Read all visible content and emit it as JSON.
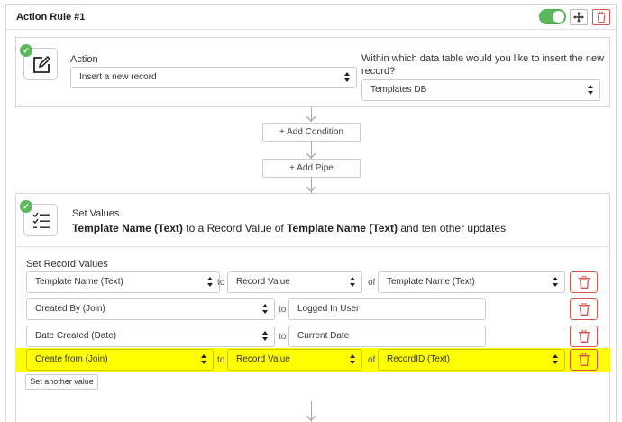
{
  "rule": {
    "title": "Action Rule #1",
    "enabled": true
  },
  "action_card": {
    "action_label": "Action",
    "action_value": "Insert a new record",
    "table_question_line1": "Within which data table would you like to insert the new",
    "table_question_line2": "record?",
    "table_value": "Templates DB"
  },
  "flow": {
    "add_condition": "+ Add Condition",
    "add_pipe": "+ Add Pipe"
  },
  "set_values": {
    "title": "Set Values",
    "desc_part1": "Template Name (Text)",
    "desc_part2": " to a Record Value of ",
    "desc_part3": "Template Name (Text)",
    "desc_part4": " and ten other updates",
    "section_label": "Set Record Values",
    "rows": [
      {
        "field": "Template Name (Text)",
        "to": "to",
        "source": "Record Value",
        "of": "of",
        "target": "Template Name (Text)"
      },
      {
        "field": "Created By (Join)",
        "to": "to",
        "source": "Logged In User"
      },
      {
        "field": "Date Created (Date)",
        "to": "to",
        "source": "Current Date"
      },
      {
        "field": "Create from (Join)",
        "to": "to",
        "source": "Record Value",
        "of": "of",
        "target": "RecordID (Text)"
      }
    ],
    "set_another_label": "Set another value"
  },
  "colors": {
    "toggle_on": "#5cb85c",
    "danger": "#d9534f",
    "highlight": "#ffff00"
  }
}
